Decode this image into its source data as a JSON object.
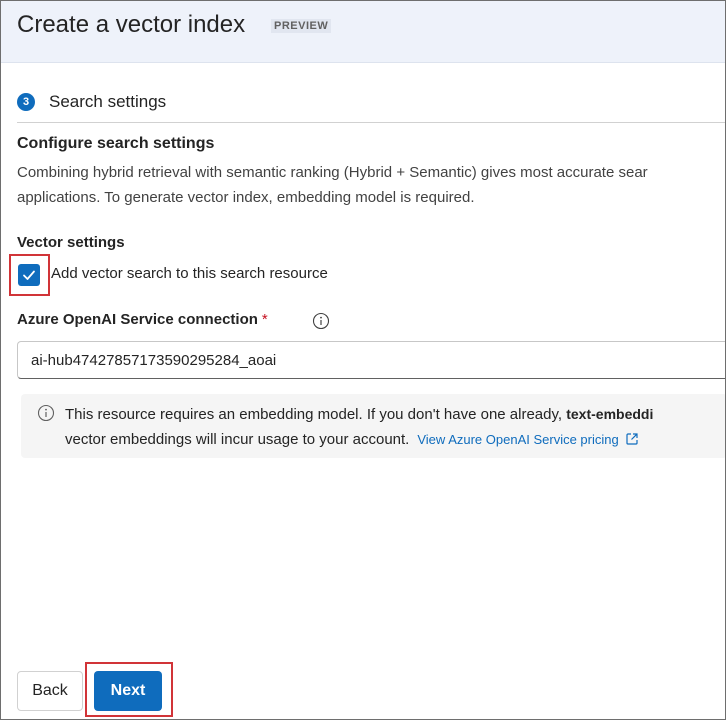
{
  "header": {
    "title": "Create a vector index",
    "badge": "PREVIEW"
  },
  "step": {
    "number": "3",
    "label": "Search settings"
  },
  "section": {
    "title": "Configure search settings",
    "description_line1": "Combining hybrid retrieval with semantic ranking (Hybrid + Semantic) gives most accurate sear",
    "description_line2": "applications. To generate vector index, embedding model is required."
  },
  "vector_settings": {
    "title": "Vector settings",
    "checkbox_label": "Add vector search to this search resource",
    "checked": true
  },
  "connection": {
    "label": "Azure OpenAI Service connection",
    "required_marker": "*",
    "value": "ai-hub47427857173590295284_aoai"
  },
  "notice": {
    "line1_text": "This resource requires an embedding model. If you don't have one already,",
    "line1_bold": "text-embeddi",
    "line2_text": "vector embeddings will incur usage to your account.",
    "link_label": "View Azure OpenAI Service pricing"
  },
  "footer": {
    "back_label": "Back",
    "next_label": "Next"
  },
  "colors": {
    "accent": "#0f6cbd",
    "highlight": "#d13438",
    "header_bg": "#eef2fa"
  },
  "icons": {
    "checkbox": "checkmark-icon",
    "info": "info-icon",
    "external": "open-external-icon"
  }
}
